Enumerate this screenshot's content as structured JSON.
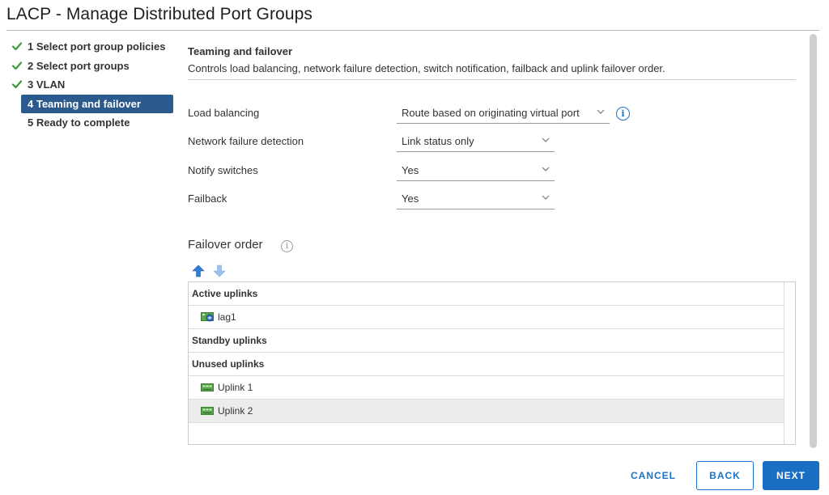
{
  "window": {
    "title": "LACP - Manage Distributed Port Groups"
  },
  "steps": [
    {
      "label": "1 Select port group policies",
      "state": "done"
    },
    {
      "label": "2 Select port groups",
      "state": "done"
    },
    {
      "label": "3 VLAN",
      "state": "done"
    },
    {
      "label": "4 Teaming and failover",
      "state": "active"
    },
    {
      "label": "5 Ready to complete",
      "state": "pending"
    }
  ],
  "section": {
    "title": "Teaming and failover",
    "description": "Controls load balancing, network failure detection, switch notification, failback and uplink failover order."
  },
  "fields": {
    "load_balancing": {
      "label": "Load balancing",
      "value": "Route based on originating virtual port"
    },
    "network_failure_detection": {
      "label": "Network failure detection",
      "value": "Link status only"
    },
    "notify_switches": {
      "label": "Notify switches",
      "value": "Yes"
    },
    "failback": {
      "label": "Failback",
      "value": "Yes"
    }
  },
  "failover": {
    "title": "Failover order",
    "info_glyph": "i",
    "active_header": "Active uplinks",
    "active_items": [
      "lag1"
    ],
    "standby_header": "Standby uplinks",
    "unused_header": "Unused uplinks",
    "unused_items": [
      "Uplink 1",
      "Uplink 2"
    ]
  },
  "info_glyph": "i",
  "footer": {
    "cancel": "CANCEL",
    "back": "BACK",
    "next": "NEXT"
  },
  "colors": {
    "accent": "#1a73c9",
    "active_step": "#2d5a8c",
    "check": "#3a9a3a",
    "selected_row": "#ececec"
  }
}
